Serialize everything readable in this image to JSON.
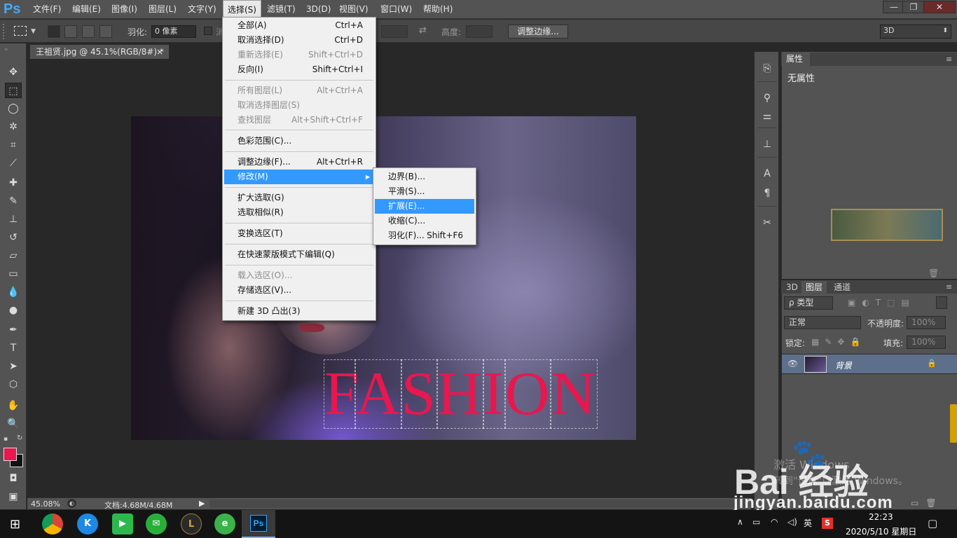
{
  "app": {
    "logo": "Ps"
  },
  "menubar": {
    "items": [
      "文件(F)",
      "编辑(E)",
      "图像(I)",
      "图层(L)",
      "文字(Y)",
      "选择(S)",
      "滤镜(T)",
      "3D(D)",
      "视图(V)",
      "窗口(W)",
      "帮助(H)"
    ],
    "active": "选择(S)"
  },
  "window_controls": {
    "minimize": "—",
    "restore": "❐",
    "close": "✕"
  },
  "options_bar": {
    "feather_label": "羽化:",
    "feather_value": "0 像素",
    "antialias_label": "消",
    "height_label": "高度:",
    "refine_edge_button": "调整边缘...",
    "workspace_value": "3D"
  },
  "document_tab": {
    "title": "王祖贤.jpg @ 45.1%(RGB/8#) *",
    "close": "×"
  },
  "canvas": {
    "text": "FASHION",
    "text_color": "#e8174f"
  },
  "colors": {
    "foreground": "#e8174f",
    "background": "#111111",
    "accent_highlight": "#3399ff"
  },
  "status_bar": {
    "zoom": "45.08%",
    "doc_info": "文档:4.68M/4.68M"
  },
  "select_menu": {
    "items": [
      {
        "label": "全部(A)",
        "shortcut": "Ctrl+A",
        "disabled": false
      },
      {
        "label": "取消选择(D)",
        "shortcut": "Ctrl+D",
        "disabled": false
      },
      {
        "label": "重新选择(E)",
        "shortcut": "Shift+Ctrl+D",
        "disabled": true
      },
      {
        "label": "反向(I)",
        "shortcut": "Shift+Ctrl+I",
        "disabled": false
      },
      {
        "label": "所有图层(L)",
        "shortcut": "Alt+Ctrl+A",
        "disabled": true
      },
      {
        "label": "取消选择图层(S)",
        "shortcut": "",
        "disabled": true
      },
      {
        "label": "查找图层",
        "shortcut": "Alt+Shift+Ctrl+F",
        "disabled": true
      },
      {
        "label": "色彩范围(C)...",
        "shortcut": "",
        "disabled": false
      },
      {
        "label": "调整边缘(F)...",
        "shortcut": "Alt+Ctrl+R",
        "disabled": false
      },
      {
        "label": "修改(M)",
        "shortcut": "",
        "disabled": false,
        "highlighted": true,
        "submenu": true
      },
      {
        "label": "扩大选取(G)",
        "shortcut": "",
        "disabled": false
      },
      {
        "label": "选取相似(R)",
        "shortcut": "",
        "disabled": false
      },
      {
        "label": "变换选区(T)",
        "shortcut": "",
        "disabled": false
      },
      {
        "label": "在快速蒙版模式下编辑(Q)",
        "shortcut": "",
        "disabled": false
      },
      {
        "label": "载入选区(O)...",
        "shortcut": "",
        "disabled": true
      },
      {
        "label": "存储选区(V)...",
        "shortcut": "",
        "disabled": false
      },
      {
        "label": "新建 3D 凸出(3)",
        "shortcut": "",
        "disabled": false
      }
    ]
  },
  "modify_submenu": {
    "items": [
      {
        "label": "边界(B)...",
        "shortcut": ""
      },
      {
        "label": "平滑(S)...",
        "shortcut": ""
      },
      {
        "label": "扩展(E)...",
        "shortcut": "",
        "highlighted": true
      },
      {
        "label": "收缩(C)...",
        "shortcut": ""
      },
      {
        "label": "羽化(F)...",
        "shortcut": "Shift+F6"
      }
    ]
  },
  "properties_panel": {
    "tab": "属性",
    "content": "无属性"
  },
  "layers_panel": {
    "tabs": [
      "3D",
      "图层",
      "通道"
    ],
    "active_tab": "图层",
    "filter_label": "ρ 类型",
    "blend_mode": "正常",
    "opacity_label": "不透明度:",
    "opacity_value": "100%",
    "lock_label": "锁定:",
    "fill_label": "填充:",
    "fill_value": "100%",
    "layer_name": "背景"
  },
  "taskbar": {
    "ime": "英",
    "time": "22:23",
    "date": "2020/5/10 星期日"
  },
  "watermark": {
    "logo_text": "Bai  经验",
    "url": "jingyan.baidu.com",
    "activate_line1": "激活 Windows",
    "activate_line2": "转到\"设置\"以激活 Windows。"
  }
}
